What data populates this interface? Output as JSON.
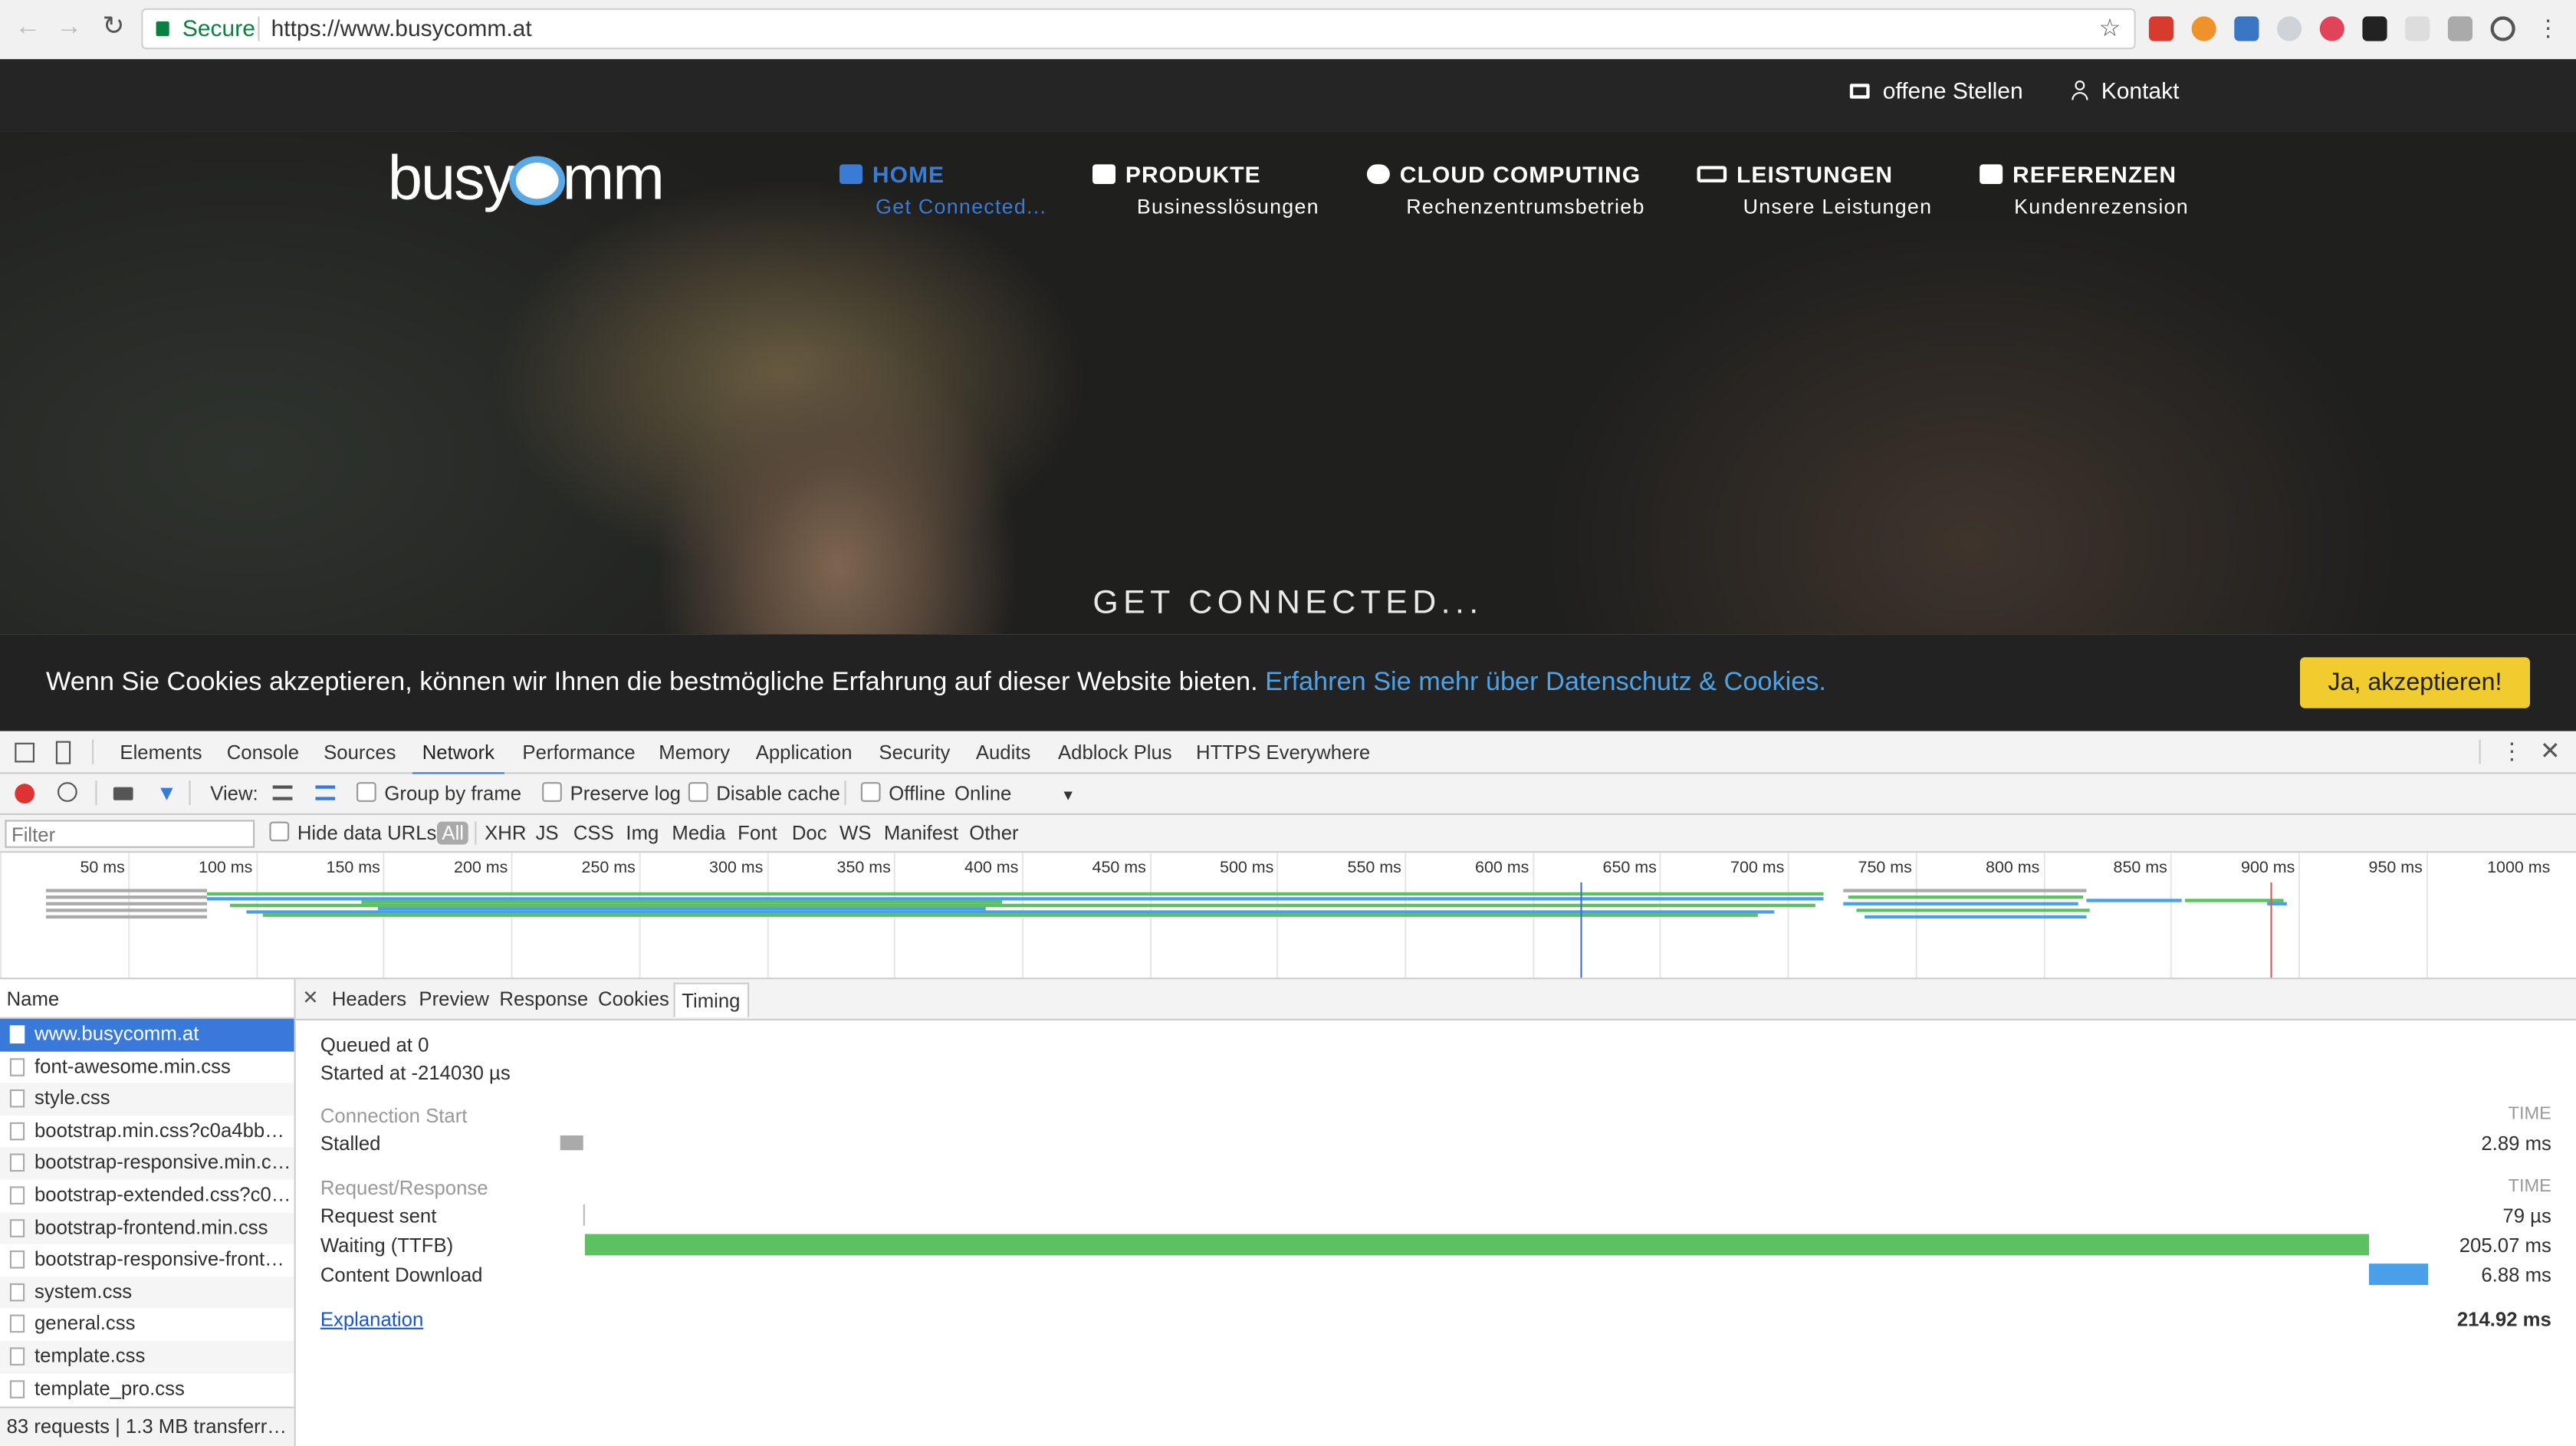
{
  "browser": {
    "secure_label": "Secure",
    "url": "https://www.busycomm.at",
    "extensions": [
      "adblock-plus-icon",
      "firefox-icon",
      "s-extension-icon",
      "skype-icon",
      "t-extension-icon",
      "fox-icon",
      "grid-icon",
      "puzzle-icon",
      "info-icon"
    ]
  },
  "site": {
    "topbar": {
      "jobs": "offene Stellen",
      "contact": "Kontakt"
    },
    "logo": {
      "part1": "busy",
      "part2": "mm"
    },
    "nav": [
      {
        "title": "HOME",
        "sub": "Get Connected..."
      },
      {
        "title": "PRODUKTE",
        "sub": "Businesslösungen"
      },
      {
        "title": "CLOUD COMPUTING",
        "sub": "Rechenzentrumsbetrieb"
      },
      {
        "title": "LEISTUNGEN",
        "sub": "Unsere Leistungen"
      },
      {
        "title": "REFERENZEN",
        "sub": "Kundenrezension"
      }
    ],
    "tagline": "GET CONNECTED...",
    "cookie": {
      "message": "Wenn Sie Cookies akzeptieren, können wir Ihnen die bestmögliche Erfahrung auf dieser Website bieten.",
      "link": "Erfahren Sie mehr über Datenschutz & Cookies.",
      "accept": "Ja, akzeptieren!"
    }
  },
  "devtools": {
    "tabs": [
      "Elements",
      "Console",
      "Sources",
      "Network",
      "Performance",
      "Memory",
      "Application",
      "Security",
      "Audits",
      "Adblock Plus",
      "HTTPS Everywhere"
    ],
    "active_tab": "Network",
    "toolbar": {
      "view": "View:",
      "group": "Group by frame",
      "preserve": "Preserve log",
      "disable_cache": "Disable cache",
      "offline": "Offline",
      "throttle": "Online"
    },
    "filter": {
      "placeholder": "Filter",
      "hide_data": "Hide data URLs",
      "types": [
        "All",
        "XHR",
        "JS",
        "CSS",
        "Img",
        "Media",
        "Font",
        "Doc",
        "WS",
        "Manifest",
        "Other"
      ]
    },
    "overview_ticks": [
      "50 ms",
      "100 ms",
      "150 ms",
      "200 ms",
      "250 ms",
      "300 ms",
      "350 ms",
      "400 ms",
      "450 ms",
      "500 ms",
      "550 ms",
      "600 ms",
      "650 ms",
      "700 ms",
      "750 ms",
      "800 ms",
      "850 ms",
      "900 ms",
      "950 ms",
      "1000 ms"
    ],
    "name_header": "Name",
    "requests": [
      "www.busycomm.at",
      "font-awesome.min.css",
      "style.css",
      "bootstrap.min.css?c0a4bbb…",
      "bootstrap-responsive.min.c…",
      "bootstrap-extended.css?c0…",
      "bootstrap-frontend.min.css",
      "bootstrap-responsive-fronte…",
      "system.css",
      "general.css",
      "template.css",
      "template_pro.css"
    ],
    "status": "83 requests | 1.3 MB transferred…",
    "detail_tabs": [
      "Headers",
      "Preview",
      "Response",
      "Cookies",
      "Timing"
    ],
    "active_detail_tab": "Timing",
    "timing": {
      "queued": "Queued at 0",
      "started": "Started at -214030 µs",
      "conn_section": "Connection Start",
      "time_label": "TIME",
      "stalled": {
        "label": "Stalled",
        "value": "2.89 ms"
      },
      "req_section": "Request/Response",
      "request_sent": {
        "label": "Request sent",
        "value": "79 µs"
      },
      "waiting": {
        "label": "Waiting (TTFB)",
        "value": "205.07 ms"
      },
      "download": {
        "label": "Content Download",
        "value": "6.88 ms"
      },
      "explanation": "Explanation",
      "total": "214.92 ms"
    }
  }
}
